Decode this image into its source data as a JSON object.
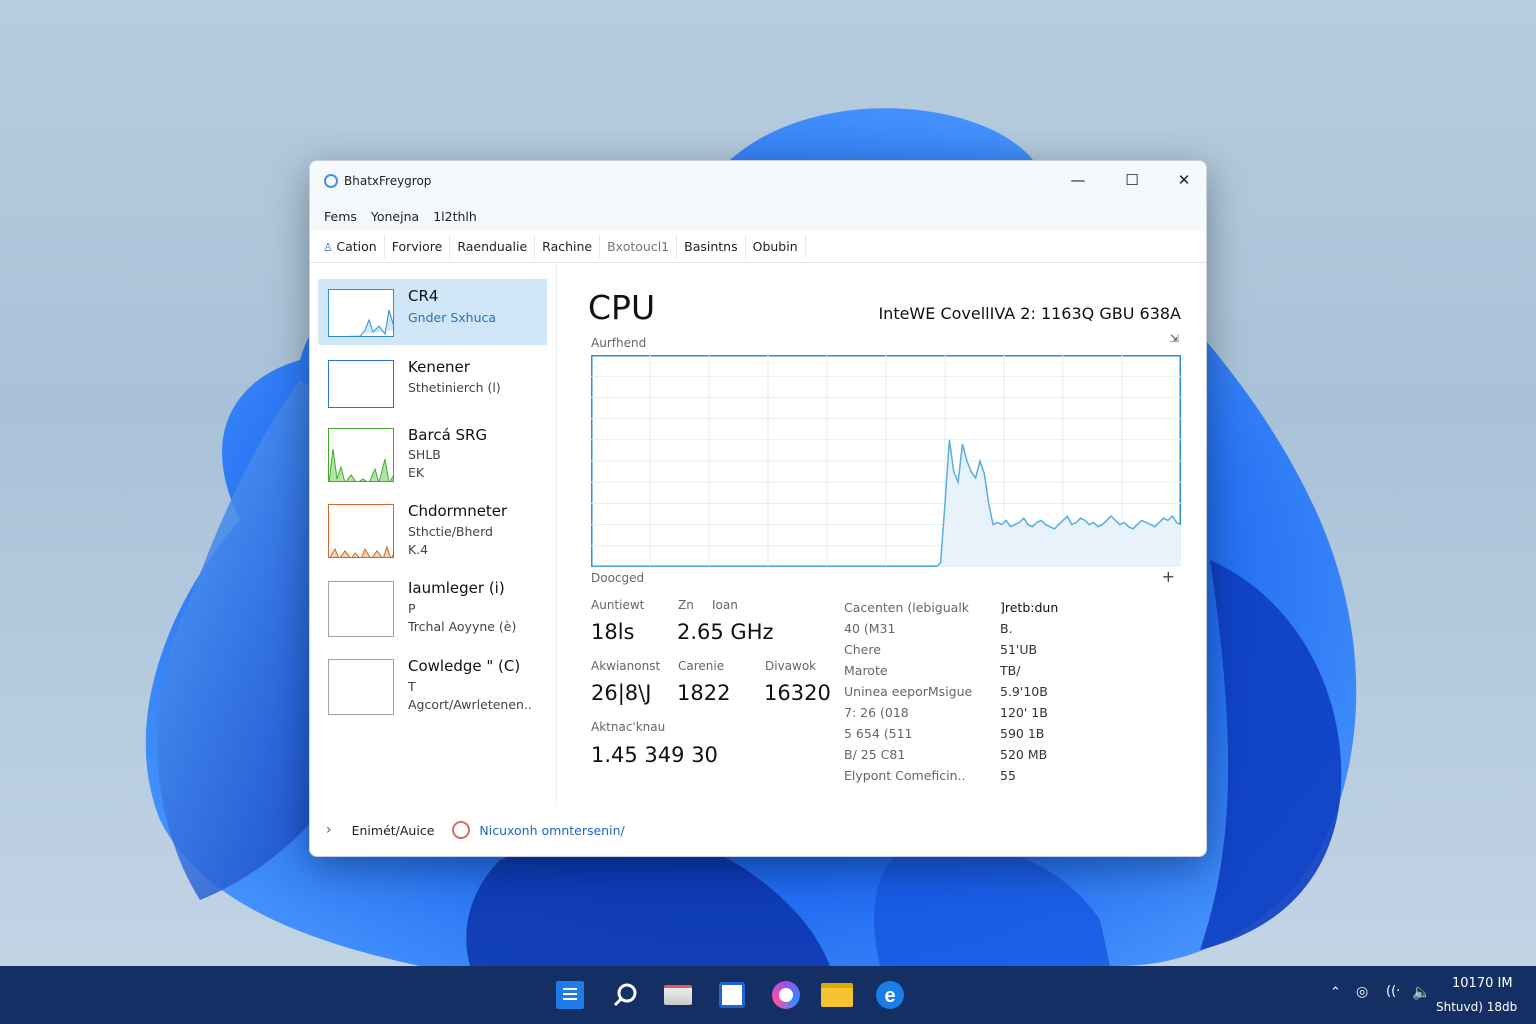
{
  "window": {
    "title": "BhatxFreygrop",
    "minimize_glyph": "—",
    "maximize_glyph": "☐",
    "close_glyph": "✕"
  },
  "menu": [
    "Fems",
    "Yonejna",
    "1l2thlh"
  ],
  "tabs": [
    {
      "label": "Cation",
      "icon": "person-icon"
    },
    {
      "label": "Forviore"
    },
    {
      "label": "Raendualie"
    },
    {
      "label": "Rachine"
    },
    {
      "label": "Bxotoucl1"
    },
    {
      "label": "Basintns"
    },
    {
      "label": "Obubin"
    }
  ],
  "sidebar": {
    "items": [
      {
        "name": "CR4",
        "sub1": "Gnder Sxhuca",
        "sub2": "",
        "color": "#2e8fd6"
      },
      {
        "name": "Kenener",
        "sub1": "Sthetinierch (l)",
        "sub2": "",
        "color": "#2e6fd3"
      },
      {
        "name": "Barcá SRG",
        "sub1": "SHLB",
        "sub2": "EK",
        "color": "#3fae2a"
      },
      {
        "name": "Chdormneter",
        "sub1": "Sthctie/Bherd",
        "sub2": "K.4",
        "color": "#c8692a"
      },
      {
        "name": "Iaumleger (i)",
        "sub1": "P",
        "sub2": "Trchal Aoyyne (è)",
        "color": "#9aa4ad"
      },
      {
        "name": "Cowledge \" (C)",
        "sub1": "T",
        "sub2": "Agcort/Awrletenen..",
        "color": "#9aa4ad"
      }
    ]
  },
  "main": {
    "title": "CPU",
    "model": "InteWE CovellIVA 2: 1163Q GBU 638A",
    "graph_top_label": "Aurfhend",
    "graph_corner": "⇲",
    "graph_bottom_label": "Doocged",
    "graph_plus": "+",
    "stats": [
      {
        "label": "Auntiewt",
        "value": "18ls"
      },
      {
        "label": "Zn",
        "value": ""
      },
      {
        "label": "Ioan",
        "value": "2.65 GHz"
      },
      {
        "label": "Akwianonst",
        "value": "26|8\\J"
      },
      {
        "label": "Carenie",
        "value": "1822"
      },
      {
        "label": "Divawok",
        "value": "16320"
      },
      {
        "label": "Aktnac'knau",
        "value": "1.45 349 30"
      }
    ],
    "details": [
      {
        "key": "Cacenten (lebigualk",
        "value": "]retb:dun"
      },
      {
        "key": "40 (M31",
        "value": "B."
      },
      {
        "key": "Chere",
        "value": "51'UB"
      },
      {
        "key": "Marote",
        "value": "TB/"
      },
      {
        "key": "Uninea eeporMsigue",
        "value": "5.9'10B"
      },
      {
        "key": "7: 26 (018",
        "value": "120' 1B"
      },
      {
        "key": "5 654 (511",
        "value": "590 1B"
      },
      {
        "key": "B/ 25 C81",
        "value": "520 MB"
      },
      {
        "key": "Elypont Comeficin..",
        "value": "55"
      }
    ]
  },
  "footer": {
    "chevron": "›",
    "fewer_details": "Enimét/Auice",
    "monitor_link": "Nicuxonh omntersenin/"
  },
  "taskbar": {
    "clock_time": "10170 IM",
    "clock_date": "Shtuvd) 18db",
    "icons": [
      "start-icon",
      "search-icon",
      "task-view-icon",
      "widgets-icon",
      "chat-icon",
      "file-explorer-icon",
      "edge-icon"
    ]
  },
  "chart_data": {
    "type": "area",
    "title": "CPU",
    "xlabel": "",
    "ylabel": "",
    "ylim": [
      0,
      100
    ],
    "series": [
      {
        "name": "",
        "values": [
          0,
          0,
          0,
          0,
          0,
          0,
          0,
          0,
          0,
          0,
          0,
          0,
          0,
          0,
          0,
          0,
          0,
          0,
          0,
          0,
          0,
          0,
          0,
          0,
          0,
          0,
          0,
          0,
          0,
          0,
          0,
          0,
          0,
          0,
          0,
          0,
          0,
          0,
          0,
          0,
          0,
          0,
          0,
          0,
          0,
          0,
          0,
          0,
          0,
          0,
          0,
          0,
          0,
          0,
          0,
          0,
          0,
          0,
          0,
          0,
          0,
          0,
          0,
          0,
          0,
          0,
          0,
          0,
          0,
          0,
          0,
          0,
          0,
          0,
          0,
          0,
          0,
          0,
          0,
          0,
          2,
          30,
          60,
          45,
          40,
          58,
          50,
          45,
          42,
          50,
          44,
          30,
          20,
          21,
          20,
          22,
          19,
          20,
          21,
          23,
          20,
          19,
          21,
          22,
          20,
          19,
          18,
          20,
          22,
          24,
          20,
          21,
          23,
          22,
          20,
          21,
          19,
          20,
          22,
          24,
          22,
          20,
          21,
          19,
          18,
          20,
          22,
          21,
          20,
          19,
          21,
          23,
          22,
          24,
          21,
          20
        ]
      }
    ]
  }
}
